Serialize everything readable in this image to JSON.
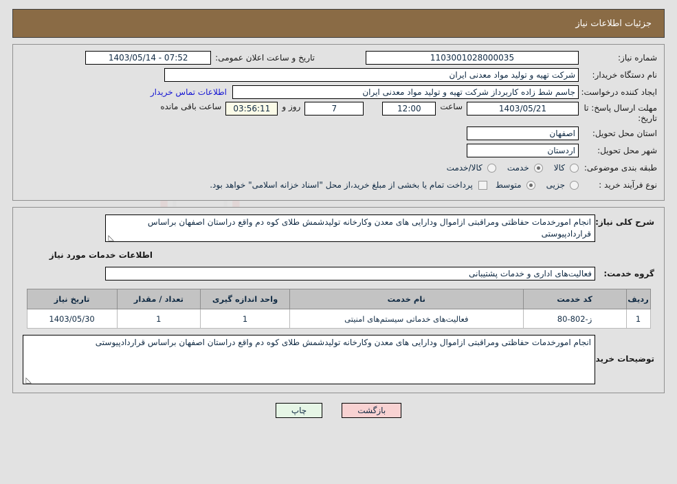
{
  "header": {
    "title": "جزئیات اطلاعات نیاز"
  },
  "fields": {
    "need_number_label": "شماره نیاز:",
    "need_number_value": "1103001028000035",
    "announce_label": "تاریخ و ساعت اعلان عمومی:",
    "announce_value": "1403/05/14 - 07:52",
    "buyer_org_label": "نام دستگاه خریدار:",
    "buyer_org_value": "شرکت تهیه و تولید مواد معدنی ایران",
    "creator_label": "ایجاد کننده درخواست:",
    "creator_value": "جاسم شط زاده کاربرداز شرکت تهیه و تولید مواد معدنی ایران",
    "contact_link": "اطلاعات تماس خریدار",
    "deadline_label": "مهلت ارسال پاسخ: تا تاریخ:",
    "deadline_date": "1403/05/21",
    "deadline_hour_label": "ساعت",
    "deadline_hour": "12:00",
    "days_left": "7",
    "days_label": "روز و",
    "time_left": "03:56:11",
    "time_left_label": "ساعت باقی مانده",
    "province_label": "استان محل تحویل:",
    "province_value": "اصفهان",
    "city_label": "شهر محل تحویل:",
    "city_value": "اردستان",
    "category_label": "طبقه بندی موضوعی:",
    "process_label": "نوع فرآیند خرید :",
    "treasury_note": "پرداخت تمام یا بخشی از مبلغ خرید،از محل \"اسناد خزانه اسلامی\" خواهد بود."
  },
  "category_options": [
    {
      "label": "کالا",
      "selected": false
    },
    {
      "label": "خدمت",
      "selected": true
    },
    {
      "label": "کالا/خدمت",
      "selected": false
    }
  ],
  "process_options": [
    {
      "label": "جزیی",
      "selected": false
    },
    {
      "label": "متوسط",
      "selected": true
    }
  ],
  "description": {
    "summary_label": "شرح کلی نیاز:",
    "summary_value": "انجام امورخدمات حفاظتی ومراقبتی ازاموال ودارایی های معدن وکارخانه تولیدشمش طلای کوه دم واقع دراستان اصفهان براساس قراردادپیوستی",
    "section_title": "اطلاعات خدمات مورد نیاز",
    "service_group_label": "گروه خدمت:",
    "service_group_value": "فعالیت‌های اداری و خدمات پشتیبانی",
    "buyer_notes_label": "توضیحات خریدار:",
    "buyer_notes_value": "انجام امورخدمات حفاظتی ومراقبتی ازاموال ودارایی های معدن وکارخانه تولیدشمش طلای کوه دم واقع دراستان اصفهان براساس قراردادپیوستی"
  },
  "table": {
    "columns": [
      "ردیف",
      "کد خدمت",
      "نام خدمت",
      "واحد اندازه گیری",
      "تعداد / مقدار",
      "تاریخ نیاز"
    ],
    "rows": [
      {
        "index": "1",
        "code": "ز-802-80",
        "name": "فعالیت‌های خدماتی سیستم‌های امنیتی",
        "unit": "1",
        "quantity": "1",
        "date": "1403/05/30"
      }
    ]
  },
  "buttons": {
    "back": "بازگشت",
    "print": "چاپ"
  },
  "watermark": {
    "text": "AriaTender.ir"
  },
  "colors": {
    "header_bg": "#8a6b45",
    "page_bg": "#e2e2e2",
    "link": "#1414d2",
    "table_header_bg": "#c3c3c3",
    "btn_back_bg": "#f8d2d2",
    "btn_print_bg": "#e6f6e6"
  }
}
